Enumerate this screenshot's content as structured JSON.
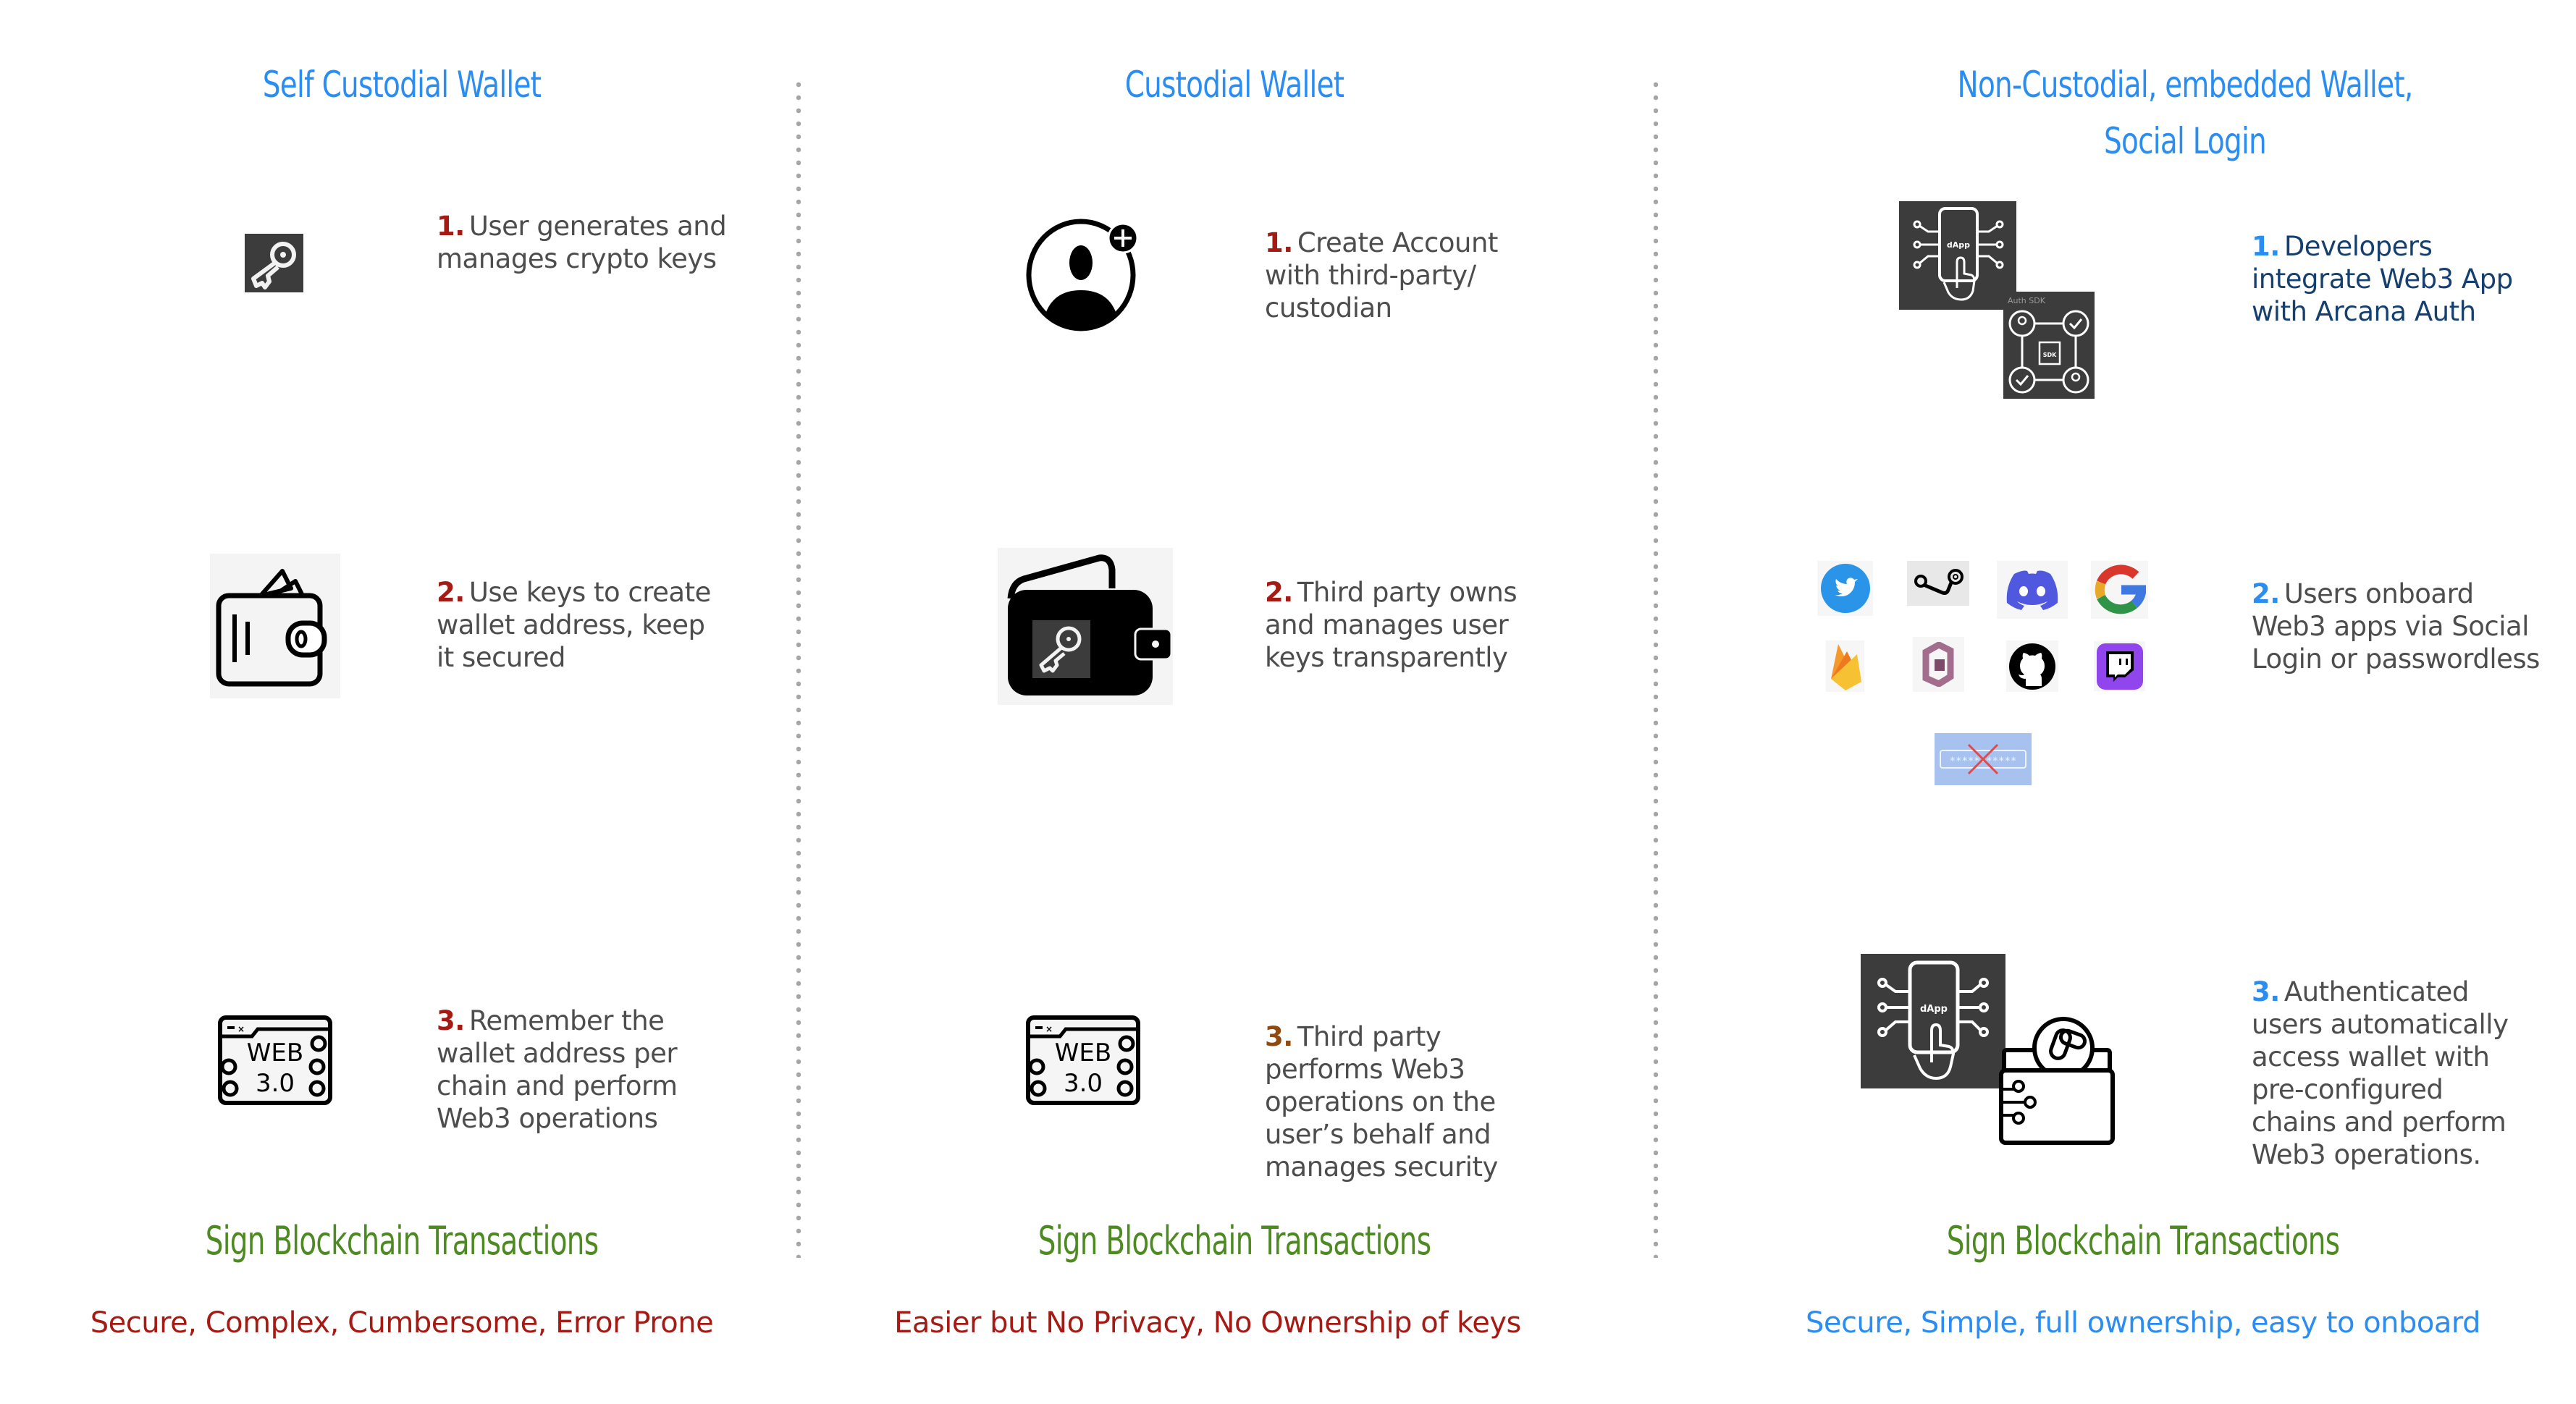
{
  "columns": [
    {
      "title_lines": [
        "Self Custodial Wallet"
      ],
      "steps": [
        {
          "num": "1.",
          "text": "User generates and manages crypto keys",
          "lines": [
            "User generates and",
            "manages crypto keys"
          ],
          "icon": "key-icon"
        },
        {
          "num": "2.",
          "text": "Use keys to create wallet address,  keep it secured",
          "lines": [
            "Use keys to create",
            "wallet address,  keep",
            "it secured"
          ],
          "icon": "wallet-icon"
        },
        {
          "num": "3.",
          "text": "Remember the wallet address per chain and perform Web3 operations",
          "lines": [
            "Remember the",
            "wallet address per",
            "chain and perform",
            "Web3 operations"
          ],
          "icon": "web3-browser-icon"
        }
      ],
      "sign_label": "Sign Blockchain Transactions",
      "summary": "Secure, Complex, Cumbersome, Error Prone",
      "accent_color": "#a51b14"
    },
    {
      "title_lines": [
        "Custodial Wallet"
      ],
      "steps": [
        {
          "num": "1.",
          "text": "Create Account with third-party/ custodian",
          "lines": [
            "Create Account",
            "with third-party/",
            "custodian"
          ],
          "icon": "add-user-icon"
        },
        {
          "num": "2.",
          "text": "Third party owns and manages user keys transparently",
          "lines": [
            "Third party owns",
            "and manages user",
            "keys transparently"
          ],
          "icon": "wallet-key-icon"
        },
        {
          "num": "3.",
          "text": "Third party performs Web3 operations on the user’s behalf and manages security",
          "lines": [
            "Third party",
            "performs Web3",
            "operations on the",
            "user’s behalf and",
            "manages security"
          ],
          "icon": "web3-browser-icon"
        }
      ],
      "sign_label": "Sign Blockchain Transactions",
      "summary": "Easier but No Privacy, No Ownership of keys",
      "accent_color": "#a51b14"
    },
    {
      "title_lines": [
        "Non-Custodial, embedded Wallet,",
        "Social Login"
      ],
      "steps": [
        {
          "num": "1.",
          "text": "Developers integrate Web3 App with Arcana Auth",
          "lines": [
            "Developers",
            "integrate Web3 App",
            "with Arcana Auth"
          ],
          "icon": "dapp-auth-sdk-icon"
        },
        {
          "num": "2.",
          "text": "Users onboard Web3 apps via Social Login or passwordless",
          "lines": [
            "Users onboard",
            "Web3 apps via Social",
            "Login or passwordless"
          ],
          "icon": "social-login-icons"
        },
        {
          "num": "3.",
          "text": "Authenticated users automatically access wallet with pre-configured chains and perform Web3 operations.",
          "lines": [
            "Authenticated",
            "users automatically",
            "access wallet with",
            "pre-configured",
            "chains and perform",
            "Web3 operations."
          ],
          "icon": "dapp-wallet-icon"
        }
      ],
      "sign_label": "Sign Blockchain Transactions",
      "summary": "Secure, Simple, full ownership, easy to onboard",
      "accent_color": "#2a8df2"
    }
  ],
  "icon_labels": {
    "dapp": "dApp",
    "auth_sdk": "Auth SDK",
    "sdk": "SDK",
    "web": "WEB",
    "web_version": "3.0",
    "password_mask": "*****-*****"
  },
  "social_providers": [
    "Twitter",
    "Steam",
    "Discord",
    "Google",
    "Firebase",
    "AWS Cognito",
    "GitHub",
    "Twitch"
  ],
  "colors": {
    "title_blue": "#2a8df2",
    "step_red": "#a51b14",
    "step_brown": "#8f4a12",
    "step_navy": "#143f6e",
    "sign_green": "#4d8a22",
    "body_gray": "#4d4d4d",
    "divider_gray": "#a6a6a6"
  }
}
